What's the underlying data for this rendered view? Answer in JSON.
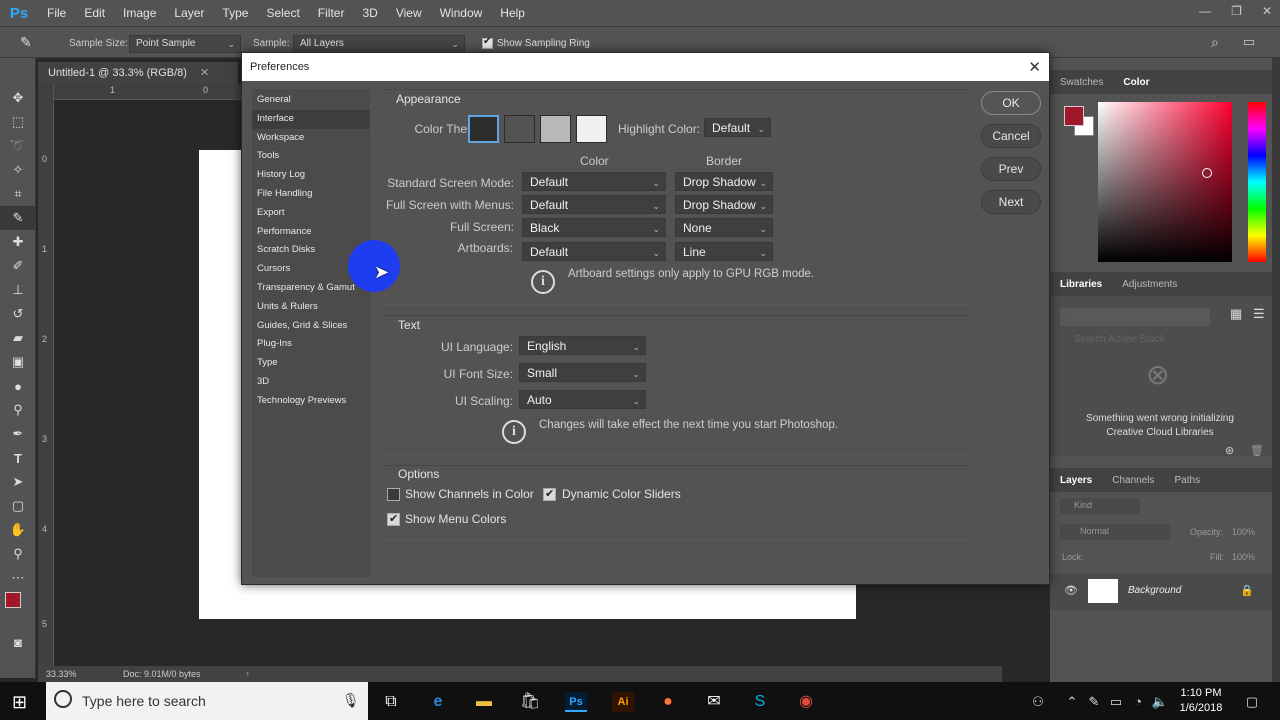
{
  "app": {
    "logo": "Ps"
  },
  "menubar": {
    "items": [
      "File",
      "Edit",
      "Image",
      "Layer",
      "Type",
      "Select",
      "Filter",
      "3D",
      "View",
      "Window",
      "Help"
    ]
  },
  "window_controls": {
    "minimize": "—",
    "restore": "❐",
    "close": "✕"
  },
  "options_bar": {
    "sample_size_label": "Sample Size:",
    "sample_size_value": "Point Sample",
    "sample_label": "Sample:",
    "sample_value": "All Layers",
    "show_sampling_ring_label": "Show Sampling Ring",
    "show_sampling_ring_checked": true
  },
  "document": {
    "tab_title": "Untitled-1 @ 33.3% (RGB/8)",
    "tab_close": "✕",
    "zoom": "33.33%",
    "doc_info": "Doc: 9.01M/0 bytes",
    "ruler_top_ticks": [
      "1",
      "0"
    ],
    "ruler_left_ticks": [
      "0",
      "1",
      "2",
      "3",
      "4",
      "5"
    ]
  },
  "right_panels": {
    "color_tabs": [
      "Swatches",
      "Color"
    ],
    "libraries_tabs": [
      "Libraries",
      "Adjustments"
    ],
    "libraries_search_placeholder": "Search Adobe Stock",
    "libraries_error": "Something went wrong initializing Creative Cloud Libraries",
    "layers_tabs": [
      "Layers",
      "Channels",
      "Paths"
    ],
    "layers_kind": "Kind",
    "blend_mode": "Normal",
    "opacity_label": "Opacity:",
    "opacity_value": "100%",
    "lock_label": "Lock:",
    "fill_label": "Fill:",
    "fill_value": "100%",
    "layer_name": "Background"
  },
  "dialog": {
    "title": "Preferences",
    "close": "✕",
    "categories": [
      "General",
      "Interface",
      "Workspace",
      "Tools",
      "History Log",
      "File Handling",
      "Export",
      "Performance",
      "Scratch Disks",
      "Cursors",
      "Transparency & Gamut",
      "Units & Rulers",
      "Guides, Grid & Slices",
      "Plug-Ins",
      "Type",
      "3D",
      "Technology Previews"
    ],
    "selected_category": "Interface",
    "buttons": {
      "ok": "OK",
      "cancel": "Cancel",
      "prev": "Prev",
      "next": "Next"
    },
    "appearance": {
      "title": "Appearance",
      "color_theme_label": "Color Theme:",
      "theme_colors": [
        "#2d2d2d",
        "#535353",
        "#b8b8b8",
        "#f0f0f0"
      ],
      "selected_theme": 0,
      "highlight_color_label": "Highlight Color:",
      "highlight_color_value": "Default",
      "col_color": "Color",
      "col_border": "Border",
      "rows": [
        {
          "label": "Standard Screen Mode:",
          "color": "Default",
          "border": "Drop Shadow"
        },
        {
          "label": "Full Screen with Menus:",
          "color": "Default",
          "border": "Drop Shadow"
        },
        {
          "label": "Full Screen:",
          "color": "Black",
          "border": "None"
        },
        {
          "label": "Artboards:",
          "color": "Default",
          "border": "Line"
        }
      ],
      "note": "Artboard settings only apply to GPU RGB mode."
    },
    "text": {
      "title": "Text",
      "ui_language_label": "UI Language:",
      "ui_language_value": "English",
      "ui_font_size_label": "UI Font Size:",
      "ui_font_size_value": "Small",
      "ui_scaling_label": "UI Scaling:",
      "ui_scaling_value": "Auto",
      "note": "Changes will take effect the next time you start Photoshop."
    },
    "options": {
      "title": "Options",
      "show_channels_label": "Show Channels in Color",
      "show_channels_checked": false,
      "dynamic_sliders_label": "Dynamic Color Sliders",
      "dynamic_sliders_checked": true,
      "show_menu_colors_label": "Show Menu Colors",
      "show_menu_colors_checked": true
    }
  },
  "taskbar": {
    "search_placeholder": "Type here to search",
    "time": "1:10 PM",
    "date": "1/6/2018"
  },
  "colors": {
    "foreground": "#a0182a",
    "ps_blue": "#31a8ff",
    "halo": "#1a3cff"
  }
}
